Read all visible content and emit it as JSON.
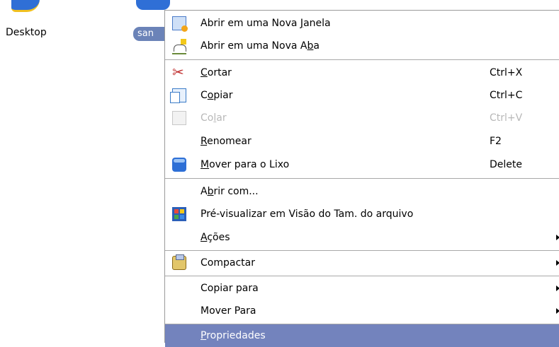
{
  "desktop": {
    "icons": [
      {
        "label": "Desktop"
      },
      {
        "label": "san"
      }
    ]
  },
  "menu": {
    "items": [
      {
        "pre": "Abrir em uma Nova ",
        "ul": "J",
        "post": "anela",
        "shortcut": "",
        "icon": "new-window-icon"
      },
      {
        "pre": "Abrir em uma Nova A",
        "ul": "b",
        "post": "a",
        "shortcut": "",
        "icon": "new-tab-icon"
      },
      {
        "pre": "",
        "ul": "C",
        "post": "ortar",
        "shortcut": "Ctrl+X",
        "icon": "scissors-icon"
      },
      {
        "pre": "C",
        "ul": "o",
        "post": "piar",
        "shortcut": "Ctrl+C",
        "icon": "copy-icon"
      },
      {
        "pre": "Co",
        "ul": "l",
        "post": "ar",
        "shortcut": "Ctrl+V",
        "icon": "paste-icon",
        "disabled": true
      },
      {
        "pre": "",
        "ul": "R",
        "post": "enomear",
        "shortcut": "F2",
        "icon": ""
      },
      {
        "pre": "",
        "ul": "M",
        "post": "over para o Lixo",
        "shortcut": "Delete",
        "icon": "trash-icon"
      },
      {
        "pre": "A",
        "ul": "b",
        "post": "rir com...",
        "shortcut": "",
        "icon": ""
      },
      {
        "pre": "",
        "ul": "",
        "post": "Pré-visualizar em Visão do Tam. do arquivo",
        "shortcut": "",
        "icon": "preview-icon"
      },
      {
        "pre": "",
        "ul": "A",
        "post": "ções",
        "shortcut": "",
        "icon": "",
        "submenu": true
      },
      {
        "pre": "",
        "ul": "",
        "post": "Compactar",
        "shortcut": "",
        "icon": "compress-icon",
        "submenu": true
      },
      {
        "pre": "",
        "ul": "",
        "post": "Copiar para",
        "shortcut": "",
        "icon": "",
        "submenu": true
      },
      {
        "pre": "",
        "ul": "",
        "post": "Mover Para",
        "shortcut": "",
        "icon": "",
        "submenu": true
      },
      {
        "pre": "",
        "ul": "P",
        "post": "ropriedades",
        "shortcut": "",
        "icon": "",
        "highlighted": true
      }
    ]
  },
  "colors": {
    "highlight": "#7383bd",
    "disabled_text": "#b8b8b8",
    "badge": "#6b83b8"
  }
}
